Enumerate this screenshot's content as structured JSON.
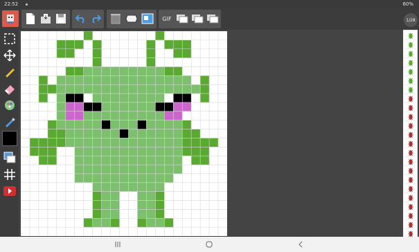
{
  "status_bar": {
    "time": "22:52",
    "battery": "60%"
  },
  "toolbar": {
    "buttons": [
      "app-logo",
      "new-file",
      "open-file",
      "save-file",
      "undo",
      "redo",
      "clear-canvas",
      "fill-shape",
      "save-image",
      "gif-export",
      "add-frame",
      "duplicate-frame",
      "delete-frame"
    ],
    "gif_label": "GIF"
  },
  "frames": {
    "counter": "1/28",
    "count": 23
  },
  "tools": [
    "select",
    "move",
    "pencil",
    "eraser",
    "color-picker",
    "eyedropper",
    "current-color",
    "layers",
    "grid",
    "video"
  ],
  "colors": {
    "primary": "#000000",
    "alien_body": "#7cbf6c",
    "alien_dark": "#5aaa32",
    "alien_cheek": "#cc66cc",
    "toolbar_accent": "#4d9be0",
    "video_red": "#d32f2f"
  },
  "pixel_art": {
    "grid_cols": 23,
    "grid_rows": 23,
    "legend": {
      ".": "empty",
      "d": "dark-green",
      "g": "light-green",
      "k": "black",
      "w": "white",
      "p": "pink"
    },
    "rows": [
      ".......d.......d.......",
      "....ddd.d.....d.ddd....",
      "....dd..d.....d..dd....",
      "........d.....d........",
      ".....ddgggggggggdd.....",
      "..d.ggggggggggggggg.d..",
      "..ddggggggggggggggggd..",
      "..d.gkkwggggggggwkk.d..",
      "....gppkkggggggkkpp....",
      "....gppgggggggggpp.....",
      "...dgggggkgggkggggd....",
      "...ddggggggkggggggdd...",
      ".ddddgggggggggggggdddd.",
      ".ddd..ggggggggggggddd..",
      "..dd..gggggggggggg.dd..",
      "......gggggggggggg.....",
      "......ggggggggggg......",
      "........gggggggg.......",
      "........dgg..ggd.......",
      "........dgg..ggd.......",
      "........dgg..ggd.......",
      ".......dggd..dggd......",
      "......................."
    ]
  },
  "nav": [
    "recent-apps",
    "home",
    "back"
  ]
}
